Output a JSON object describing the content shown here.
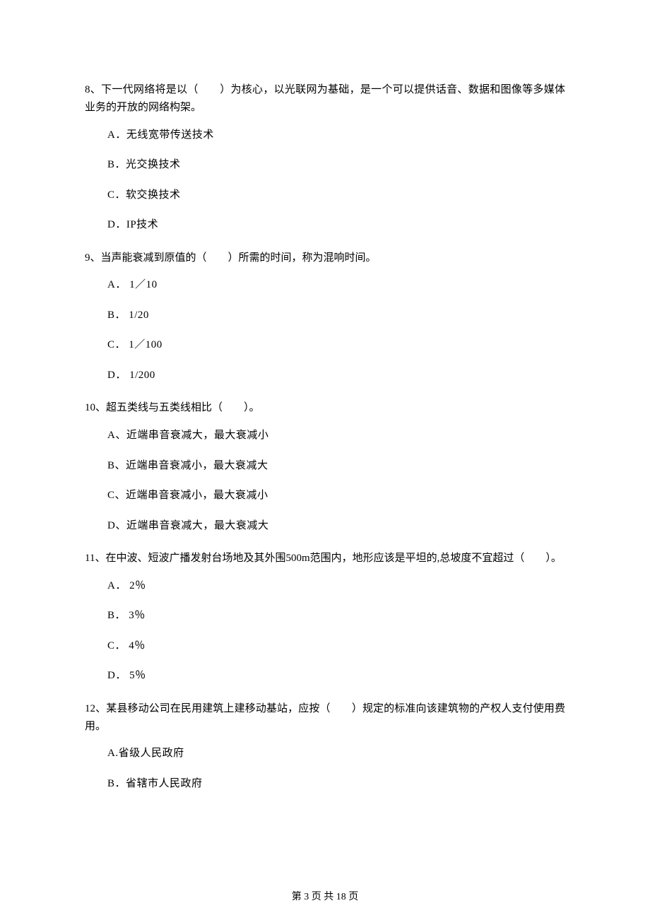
{
  "q8": {
    "text": "8、下一代网络将是以（　　）为核心，以光联网为基础，是一个可以提供话音、数据和图像等多媒体业务的开放的网络构架。",
    "A": "A．无线宽带传送技术",
    "B": "B．光交换技术",
    "C": "C．软交换技术",
    "D": "D．IP技术"
  },
  "q9": {
    "text": "9、当声能衰减到原值的（　　）所需的时间，称为混响时间。",
    "A": "A．  1／10",
    "B": "B．  1/20",
    "C": "C．  1／100",
    "D": "D．  1/200"
  },
  "q10": {
    "text": "10、超五类线与五类线相比（　　）。",
    "A": "A、近端串音衰减大，最大衰减小",
    "B": "B、近端串音衰减小，最大衰减大",
    "C": "C、近端串音衰减小，最大衰减小",
    "D": "D、近端串音衰减大，最大衰减大"
  },
  "q11": {
    "text": "11、在中波、短波广播发射台场地及其外围500m范围内，地形应该是平坦的,总坡度不宜超过（　　）。",
    "A": "A．  2％",
    "B": "B．  3％",
    "C": "C．  4％",
    "D": "D．  5％"
  },
  "q12": {
    "text": "12、某县移动公司在民用建筑上建移动基站，应按（　　）规定的标准向该建筑物的产权人支付使用费用。",
    "A": "A.省级人民政府",
    "B": "B．省辖市人民政府"
  },
  "footer": "第 3 页 共 18 页"
}
